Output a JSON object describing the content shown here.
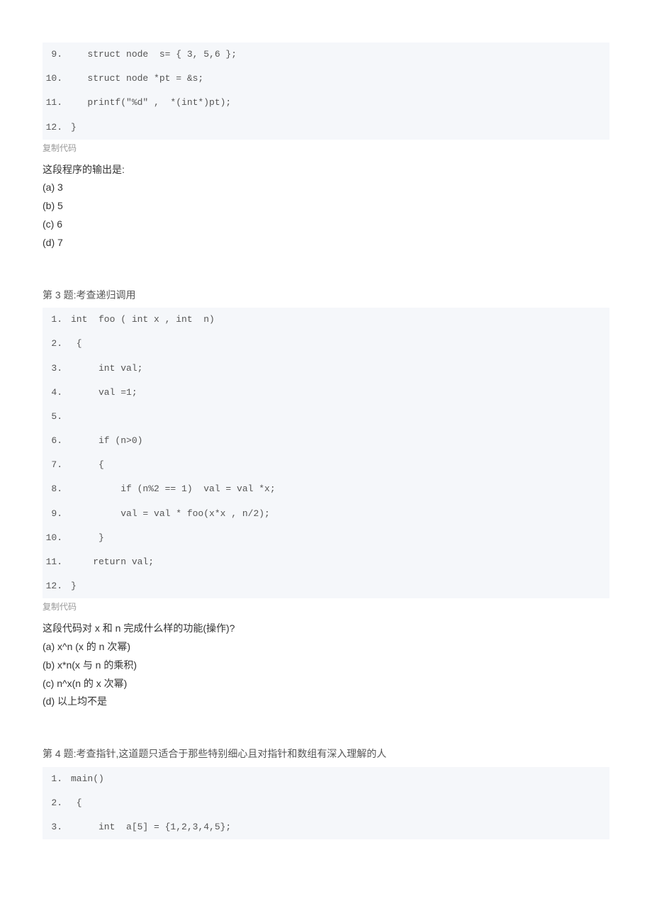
{
  "block1": {
    "lines": [
      {
        "n": "9.",
        "c": "   struct node  s= { 3, 5,6 };"
      },
      {
        "n": "10.",
        "c": "   struct node *pt = &s;"
      },
      {
        "n": "11.",
        "c": "   printf(\"%d\" ,  *(int*)pt);"
      },
      {
        "n": "12.",
        "c": "}"
      }
    ]
  },
  "copy_label": "复制代码",
  "q2_outro": {
    "stem": "这段程序的输出是:",
    "a": "(a) 3",
    "b": "(b) 5",
    "c": "(c) 6",
    "d": "(d) 7"
  },
  "q3_title": "第 3 题:考查递归调用",
  "block2": {
    "lines": [
      {
        "n": "1.",
        "c": "int  foo ( int x , int  n)"
      },
      {
        "n": "2.",
        "c": " {"
      },
      {
        "n": "3.",
        "c": "     int val;"
      },
      {
        "n": "4.",
        "c": "     val =1;"
      },
      {
        "n": "5.",
        "c": "  "
      },
      {
        "n": "6.",
        "c": "     if (n>0)"
      },
      {
        "n": "7.",
        "c": "     {"
      },
      {
        "n": "8.",
        "c": "         if (n%2 == 1)  val = val *x;"
      },
      {
        "n": "9.",
        "c": "         val = val * foo(x*x , n/2);"
      },
      {
        "n": "10.",
        "c": "     }"
      },
      {
        "n": "11.",
        "c": "    return val;"
      },
      {
        "n": "12.",
        "c": "}"
      }
    ]
  },
  "q3_outro": {
    "stem": "这段代码对 x 和 n 完成什么样的功能(操作)?",
    "a": "(a) x^n (x 的 n 次幂)",
    "b": "(b) x*n(x 与 n 的乘积)",
    "c": "(c) n^x(n 的 x 次幂)",
    "d": "(d) 以上均不是"
  },
  "q4_title": "第 4 题:考查指针,这道题只适合于那些特别细心且对指针和数组有深入理解的人",
  "block3": {
    "lines": [
      {
        "n": "1.",
        "c": "main()"
      },
      {
        "n": "2.",
        "c": " {"
      },
      {
        "n": "3.",
        "c": "     int  a[5] = {1,2,3,4,5};"
      }
    ]
  }
}
